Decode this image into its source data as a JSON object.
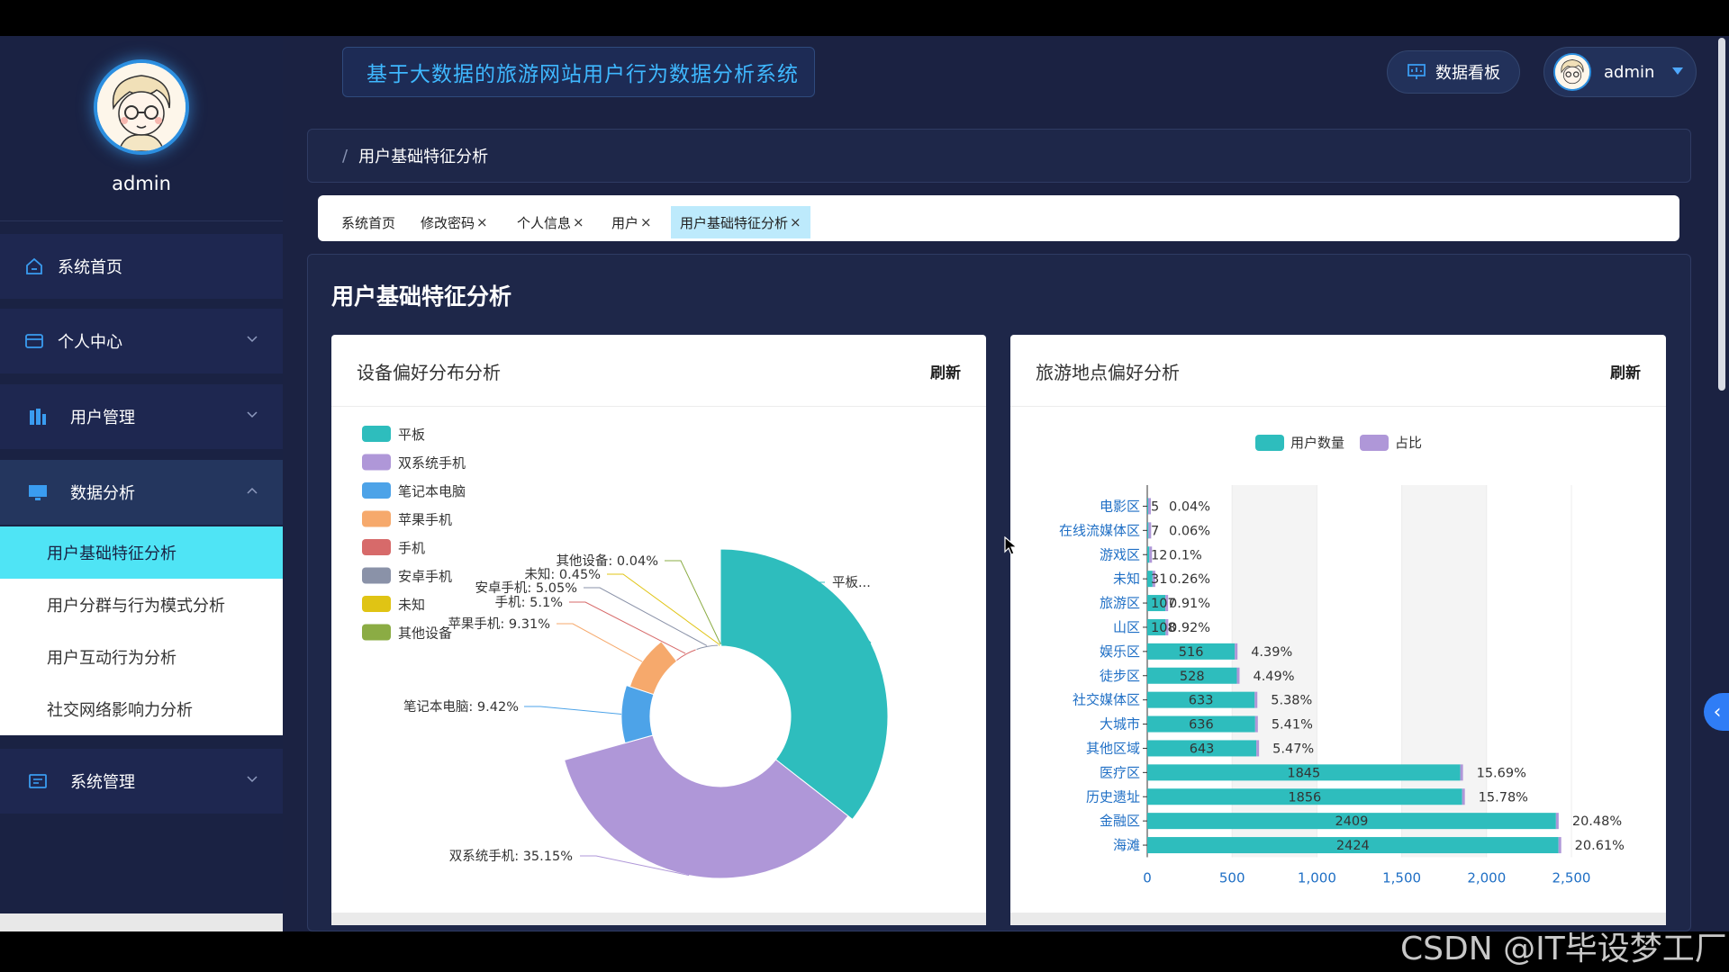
{
  "sidebar": {
    "username": "admin",
    "menu": [
      {
        "label": "系统首页",
        "icon": "home-icon"
      },
      {
        "label": "个人中心",
        "icon": "card-icon"
      },
      {
        "label": "用户管理",
        "icon": "chart-icon"
      },
      {
        "label": "数据分析",
        "icon": "monitor-icon"
      },
      {
        "label": "系统管理",
        "icon": "list-icon"
      }
    ],
    "submenu": [
      {
        "label": "用户基础特征分析"
      },
      {
        "label": "用户分群与行为模式分析"
      },
      {
        "label": "用户互动行为分析"
      },
      {
        "label": "社交网络影响力分析"
      }
    ]
  },
  "header": {
    "title": "基于大数据的旅游网站用户行为数据分析系统",
    "dashboard_label": "数据看板",
    "user_label": "admin"
  },
  "breadcrumb": {
    "separator": "/",
    "current": "用户基础特征分析"
  },
  "tags": [
    {
      "label": "系统首页",
      "closable": false
    },
    {
      "label": "修改密码",
      "closable": true
    },
    {
      "label": "个人信息",
      "closable": true
    },
    {
      "label": "用户",
      "closable": true
    },
    {
      "label": "用户基础特征分析",
      "closable": true
    }
  ],
  "page_title": "用户基础特征分析",
  "cards": [
    {
      "title": "设备偏好分布分析",
      "refresh": "刷新"
    },
    {
      "title": "旅游地点偏好分析",
      "refresh": "刷新"
    }
  ],
  "chart_data": [
    {
      "type": "pie",
      "variant": "rose-donut",
      "title": "设备偏好分布分析",
      "legend": [
        "平板",
        "双系统手机",
        "笔记本电脑",
        "苹果手机",
        "手机",
        "安卓手机",
        "未知",
        "其他设备"
      ],
      "legend_position": "top-left",
      "slices": [
        {
          "name": "平板",
          "value": 35.58,
          "label": "平板...",
          "color": "#2ebdbd"
        },
        {
          "name": "双系统手机",
          "value": 35.15,
          "label": "双系统手机: 35.15%",
          "color": "#af97d8"
        },
        {
          "name": "笔记本电脑",
          "value": 9.42,
          "label": "笔记本电脑: 9.42%",
          "color": "#4da3e8"
        },
        {
          "name": "苹果手机",
          "value": 9.31,
          "label": "苹果手机: 9.31%",
          "color": "#f6a96c"
        },
        {
          "name": "手机",
          "value": 5.1,
          "label": "手机: 5.1%",
          "color": "#d76a6a"
        },
        {
          "name": "安卓手机",
          "value": 5.05,
          "label": "安卓手机: 5.05%",
          "color": "#8a92a8"
        },
        {
          "name": "未知",
          "value": 0.45,
          "label": "未知: 0.45%",
          "color": "#e0c414"
        },
        {
          "name": "其他设备",
          "value": 0.04,
          "label": "其他设备: 0.04%",
          "color": "#8bac44"
        }
      ]
    },
    {
      "type": "bar",
      "orientation": "horizontal",
      "title": "旅游地点偏好分析",
      "legend": [
        "用户数量",
        "占比"
      ],
      "legend_position": "top-center",
      "categories": [
        "电影区",
        "在线流媒体区",
        "游戏区",
        "未知",
        "旅游区",
        "山区",
        "娱乐区",
        "徒步区",
        "社交媒体区",
        "大城市",
        "其他区域",
        "医疗区",
        "历史遗址",
        "金融区",
        "海滩"
      ],
      "series": [
        {
          "name": "用户数量",
          "color": "#2ebdbd",
          "values": [
            5,
            7,
            12,
            31,
            107,
            108,
            516,
            528,
            633,
            636,
            643,
            1845,
            1856,
            2409,
            2424
          ]
        },
        {
          "name": "占比",
          "color": "#af97d8",
          "values": [
            "0.04%",
            "0.06%",
            "0.1%",
            "0.26%",
            "0.91%",
            "0.92%",
            "4.39%",
            "4.49%",
            "5.38%",
            "5.41%",
            "5.47%",
            "15.69%",
            "15.78%",
            "20.48%",
            "20.61%"
          ]
        }
      ],
      "xlim": [
        0,
        2500
      ],
      "xticks": [
        "0",
        "500",
        "1,000",
        "1,500",
        "2,000",
        "2,500"
      ]
    }
  ],
  "watermark": "CSDN @IT毕设梦工厂"
}
